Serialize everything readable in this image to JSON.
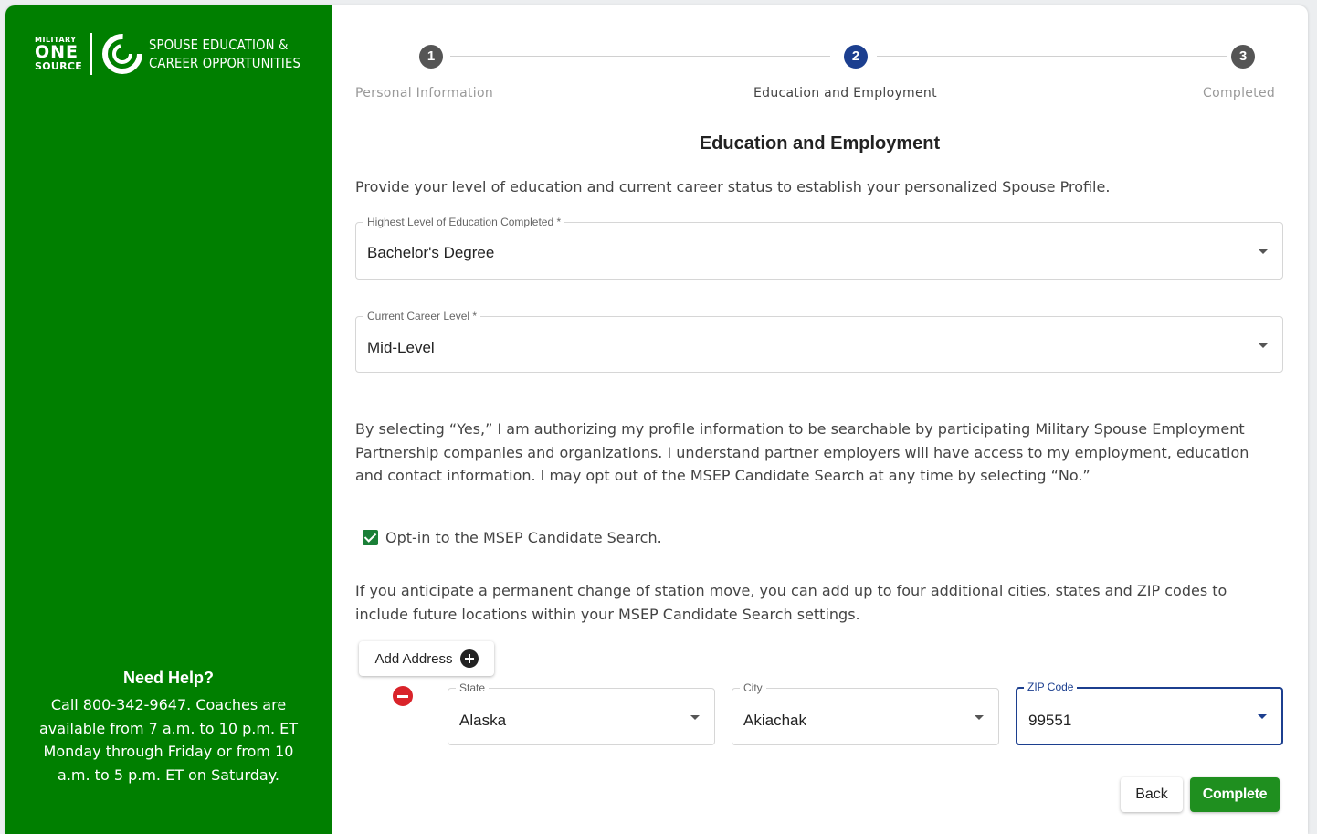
{
  "brand": {
    "mos_small": "MILITARY",
    "mos_big": "ONE",
    "mos_source": "SOURCE",
    "program_line1": "Spouse Education &",
    "program_line2": "Career Opportunities",
    "sidebar_color": "#007f00"
  },
  "help": {
    "title": "Need Help?",
    "body": "Call 800-342-9647. Coaches are available from 7 a.m. to 10 p.m. ET Monday through Friday or from 10 a.m. to 5 p.m. ET on Saturday."
  },
  "stepper": {
    "steps": [
      {
        "number": "1",
        "label": "Personal Information",
        "state": "done"
      },
      {
        "number": "2",
        "label": "Education and Employment",
        "state": "active"
      },
      {
        "number": "3",
        "label": "Completed",
        "state": "pending"
      }
    ],
    "active_color": "#1c3f8f",
    "inactive_color": "#555555"
  },
  "section_title": "Education and Employment",
  "intro": "Provide your level of education and current career status to establish your personalized Spouse Profile.",
  "education": {
    "label": "Highest Level of Education Completed *",
    "value": "Bachelor's Degree"
  },
  "career": {
    "label": "Current Career Level *",
    "value": "Mid-Level"
  },
  "consent_text": "By selecting “Yes,” I am authorizing my profile information to be searchable by participating Military Spouse Employment Partnership companies and organizations. I understand partner employers will have access to my employment, education and contact information. I may opt out of the MSEP Candidate Search at any time by selecting “No.”",
  "optin": {
    "label": "Opt-in to the MSEP Candidate Search.",
    "checked": true
  },
  "pcs_text": "If you anticipate a permanent change of station move, you can add up to four additional cities, states and ZIP codes to include future locations within your MSEP Candidate Search settings.",
  "add_address_label": "Add Address",
  "address": {
    "state": {
      "label": "State",
      "value": "Alaska"
    },
    "city": {
      "label": "City",
      "value": "Akiachak"
    },
    "zip": {
      "label": "ZIP Code",
      "value": "99551"
    }
  },
  "buttons": {
    "back": "Back",
    "complete": "Complete"
  }
}
